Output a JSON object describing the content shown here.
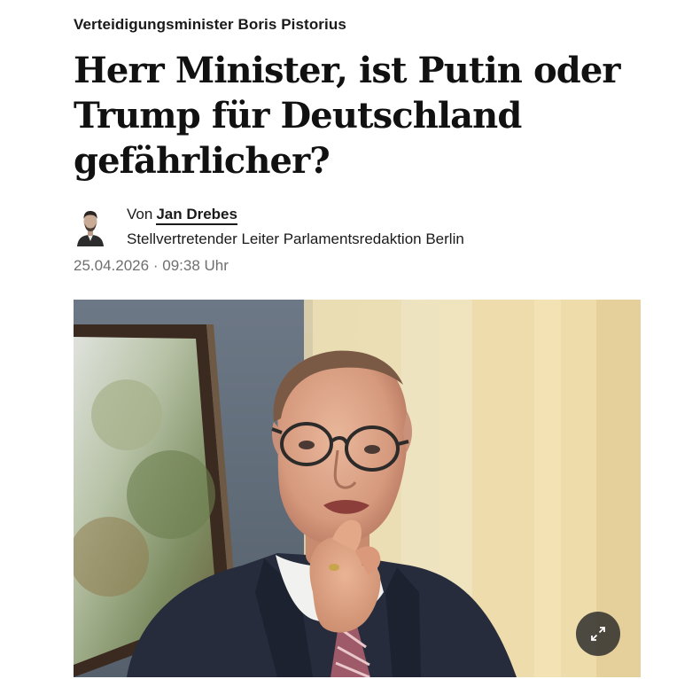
{
  "article": {
    "kicker": "Verteidigungsminister Boris Pistorius",
    "headline": "Herr Minister, ist Putin oder Trump für Deutschland gefährlicher?",
    "author": {
      "prefix": "Von",
      "name": "Jan Drebes",
      "role": "Stellvertretender Leiter Parlamentsredaktion Berlin"
    },
    "dateline": {
      "date": "25.04.2026",
      "separator": "·",
      "time": "09:38 Uhr"
    },
    "hero_image": {
      "icons": {
        "expand": "expand-arrows-icon"
      }
    }
  },
  "colors": {
    "text": "#111111",
    "muted": "#6f6f6f",
    "expand_button_bg": "#282828"
  }
}
